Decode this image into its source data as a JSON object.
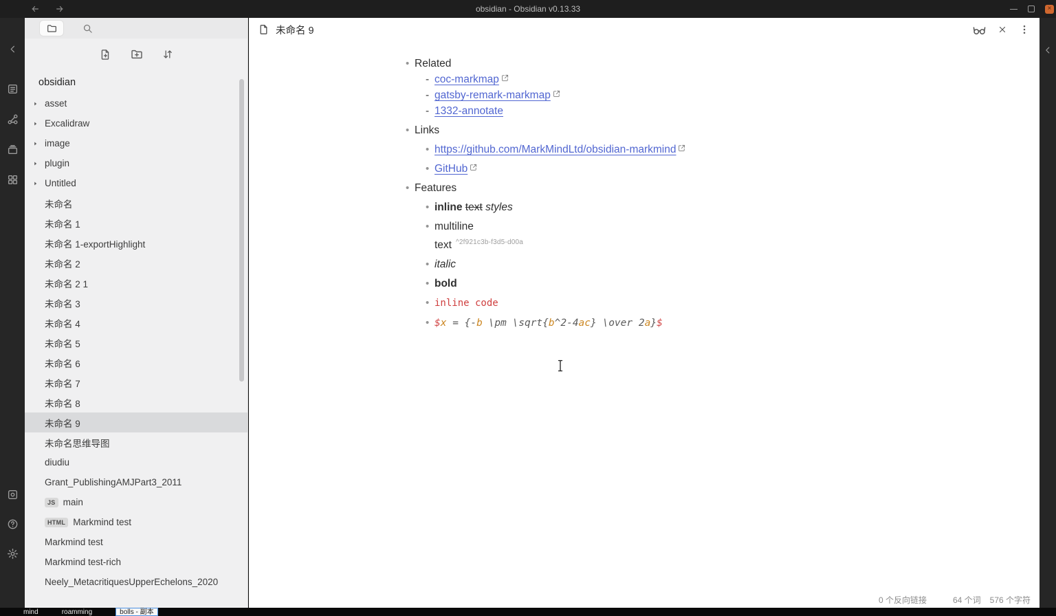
{
  "window": {
    "title": "obsidian - Obsidian v0.13.33"
  },
  "colors": {
    "link": "#5166d1",
    "inline_code": "#cf3f3f",
    "math_variable": "#cc8722",
    "math_dollar": "#d04343",
    "close_button": "#d0682f"
  },
  "ribbon": {
    "top_icons": [
      {
        "name": "quick-switcher-icon",
        "icon": "switcher"
      },
      {
        "name": "graph-view-icon",
        "icon": "graph"
      },
      {
        "name": "card-stack-icon",
        "icon": "stack"
      },
      {
        "name": "grid-plugin-icon",
        "icon": "grid"
      }
    ],
    "bottom_icons": [
      {
        "name": "frame-plugin-icon",
        "icon": "frame"
      },
      {
        "name": "help-icon",
        "icon": "help"
      },
      {
        "name": "settings-icon",
        "icon": "gear"
      }
    ]
  },
  "sidebar": {
    "vault_name": "obsidian",
    "tree": [
      {
        "type": "folder",
        "label": "asset"
      },
      {
        "type": "folder",
        "label": "Excalidraw"
      },
      {
        "type": "folder",
        "label": "image"
      },
      {
        "type": "folder",
        "label": "plugin"
      },
      {
        "type": "folder",
        "label": "Untitled"
      },
      {
        "type": "file",
        "label": "未命名"
      },
      {
        "type": "file",
        "label": "未命名 1"
      },
      {
        "type": "file",
        "label": "未命名 1-exportHighlight"
      },
      {
        "type": "file",
        "label": "未命名 2"
      },
      {
        "type": "file",
        "label": "未命名 2 1"
      },
      {
        "type": "file",
        "label": "未命名 3"
      },
      {
        "type": "file",
        "label": "未命名 4"
      },
      {
        "type": "file",
        "label": "未命名 5"
      },
      {
        "type": "file",
        "label": "未命名 6"
      },
      {
        "type": "file",
        "label": "未命名 7"
      },
      {
        "type": "file",
        "label": "未命名 8"
      },
      {
        "type": "file",
        "label": "未命名 9",
        "selected": true
      },
      {
        "type": "file",
        "label": "未命名思维导图"
      },
      {
        "type": "file",
        "label": "diudiu"
      },
      {
        "type": "file",
        "label": "Grant_PublishingAMJPart3_2011"
      },
      {
        "type": "file",
        "label": "main",
        "badge": "JS"
      },
      {
        "type": "file",
        "label": "Markmind test",
        "badge": "HTML"
      },
      {
        "type": "file",
        "label": "Markmind test"
      },
      {
        "type": "file",
        "label": "Markmind test-rich"
      },
      {
        "type": "file",
        "label": "Neely_MetacritiquesUpperEchelons_2020"
      }
    ]
  },
  "main": {
    "tab_title": "未命名 9",
    "status": [
      "0 个反向链接",
      "64 个词",
      "576 个字符"
    ]
  },
  "editor": {
    "lines": [
      {
        "indent": 1,
        "bullet": "dot",
        "gap": false,
        "segments": [
          {
            "t": "Related"
          }
        ]
      },
      {
        "indent": 2,
        "bullet": "dash",
        "gap": false,
        "segments": [
          {
            "t": "coc-markmap",
            "s": "link",
            "ext": true
          }
        ]
      },
      {
        "indent": 2,
        "bullet": "dash",
        "gap": false,
        "segments": [
          {
            "t": "gatsby-remark-markmap",
            "s": "link",
            "ext": true
          }
        ]
      },
      {
        "indent": 2,
        "bullet": "dash",
        "gap": false,
        "segments": [
          {
            "t": "1332-annotate",
            "s": "link"
          }
        ]
      },
      {
        "indent": 1,
        "bullet": "dot",
        "gap": true,
        "segments": [
          {
            "t": "Links"
          }
        ]
      },
      {
        "indent": 2,
        "bullet": "dot",
        "gap": true,
        "segments": [
          {
            "t": "https://github.com/MarkMindLtd/obsidian-markmind",
            "s": "link",
            "ext": true
          }
        ]
      },
      {
        "indent": 2,
        "bullet": "dot",
        "gap": true,
        "segments": [
          {
            "t": "GitHub",
            "s": "link",
            "ext": true
          }
        ]
      },
      {
        "indent": 1,
        "bullet": "dot",
        "gap": true,
        "segments": [
          {
            "t": "Features"
          }
        ]
      },
      {
        "indent": 2,
        "bullet": "dot",
        "gap": true,
        "segments": [
          {
            "t": "inline",
            "s": "bold"
          },
          {
            "t": " "
          },
          {
            "t": "text",
            "s": "strike"
          },
          {
            "t": " "
          },
          {
            "t": "styles",
            "s": "italic"
          }
        ]
      },
      {
        "indent": 2,
        "bullet": "dot",
        "gap": true,
        "segments": [
          {
            "t": "multiline"
          }
        ]
      },
      {
        "indent": 2,
        "bullet": "none",
        "gap": false,
        "segments": [
          {
            "t": "text"
          },
          {
            "t": "^2f921c3b-f3d5-d00a",
            "s": "blockref"
          }
        ]
      },
      {
        "indent": 2,
        "bullet": "dot",
        "gap": true,
        "segments": [
          {
            "t": "italic",
            "s": "italic"
          }
        ]
      },
      {
        "indent": 2,
        "bullet": "dot",
        "gap": true,
        "segments": [
          {
            "t": "bold",
            "s": "bold"
          }
        ]
      },
      {
        "indent": 2,
        "bullet": "dot",
        "gap": true,
        "segments": [
          {
            "t": "inline code",
            "s": "code"
          }
        ]
      },
      {
        "indent": 2,
        "bullet": "dot",
        "gap": true,
        "segments": [
          {
            "t": "$",
            "s": "math-dollar"
          },
          {
            "t": "x",
            "s": "math-var"
          },
          {
            "t": " = {-",
            "s": "math-op"
          },
          {
            "t": "b",
            "s": "math-var"
          },
          {
            "t": " \\pm \\sqrt{",
            "s": "math-op"
          },
          {
            "t": "b",
            "s": "math-var"
          },
          {
            "t": "^2-4",
            "s": "math-op"
          },
          {
            "t": "ac",
            "s": "math-var"
          },
          {
            "t": "} \\over 2",
            "s": "math-op"
          },
          {
            "t": "a",
            "s": "math-var"
          },
          {
            "t": "}",
            "s": "math-op"
          },
          {
            "t": "$",
            "s": "math-dollar"
          }
        ]
      }
    ]
  },
  "taskbar": {
    "items": [
      {
        "label": "mind"
      },
      {
        "label": "roamming"
      },
      {
        "label": "bolls - 副本",
        "active": true
      }
    ]
  }
}
